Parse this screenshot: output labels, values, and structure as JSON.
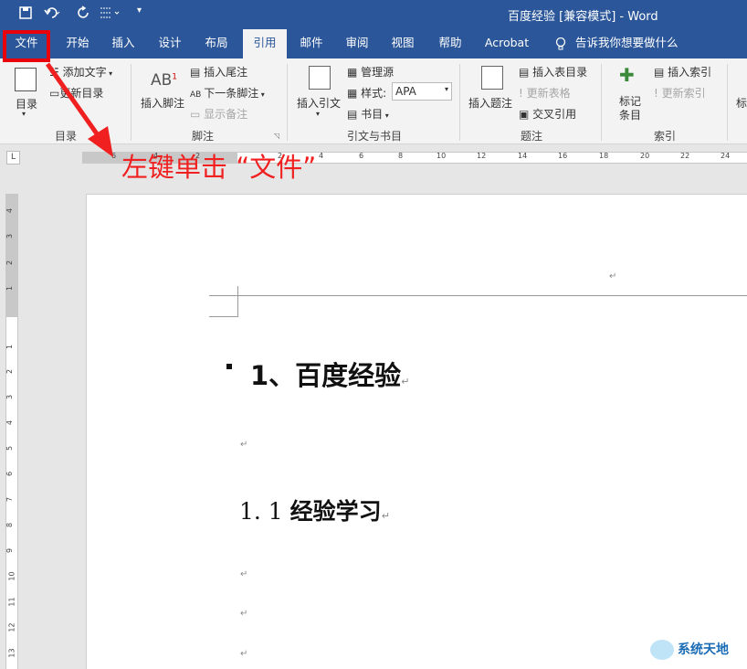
{
  "title_bar": {
    "title": "百度经验 [兼容模式] - Word",
    "save_icon": "save-icon",
    "undo_icon": "undo-icon",
    "redo_icon": "redo-icon"
  },
  "tabs": [
    {
      "label": "文件",
      "active": false
    },
    {
      "label": "开始",
      "active": false
    },
    {
      "label": "插入",
      "active": false
    },
    {
      "label": "设计",
      "active": false
    },
    {
      "label": "布局",
      "active": false
    },
    {
      "label": "引用",
      "active": true
    },
    {
      "label": "邮件",
      "active": false
    },
    {
      "label": "审阅",
      "active": false
    },
    {
      "label": "视图",
      "active": false
    },
    {
      "label": "帮助",
      "active": false
    },
    {
      "label": "Acrobat",
      "active": false
    }
  ],
  "tell_me": "告诉我你想要做什么",
  "ribbon": {
    "toc": {
      "big": "目录",
      "add_text": "添加文字",
      "update_toc": "更新目录",
      "group": "目录"
    },
    "footnotes": {
      "big": "插入脚注",
      "insert_endnote": "插入尾注",
      "next_footnote": "下一条脚注",
      "show_notes": "显示备注",
      "group": "脚注"
    },
    "citations": {
      "big": "插入引文",
      "manage_sources": "管理源",
      "style_label": "样式:",
      "style_value": "APA",
      "bibliography": "书目",
      "group": "引文与书目"
    },
    "captions": {
      "big": "插入题注",
      "insert_table_of_figures": "插入表目录",
      "update_table": "更新表格",
      "cross_reference": "交叉引用",
      "group": "题注"
    },
    "index": {
      "big": "标记条目",
      "insert_index": "插入索引",
      "update_index": "更新索引",
      "group": "索引"
    },
    "cut_off": "标"
  },
  "ruler": {
    "numbers": [
      "6",
      "4",
      "2",
      "2",
      "4",
      "6",
      "8",
      "10",
      "12",
      "14",
      "16",
      "18",
      "20",
      "22",
      "24"
    ],
    "tab_selector": "L"
  },
  "vruler": {
    "numbers": [
      "4",
      "3",
      "2",
      "1",
      "1",
      "2",
      "3",
      "4",
      "5",
      "6",
      "7",
      "8",
      "9",
      "10",
      "11",
      "12",
      "13"
    ]
  },
  "document": {
    "heading1": "1、百度经验",
    "heading2_num": "1. 1",
    "heading2_text": "经验学习",
    "para_mark": "↵"
  },
  "annotation": {
    "text": "左键单击 “文件”",
    "color": "#f02020"
  },
  "watermark": "系统天地",
  "colors": {
    "accent": "#2b579a",
    "annotation_red": "#e8000b"
  }
}
